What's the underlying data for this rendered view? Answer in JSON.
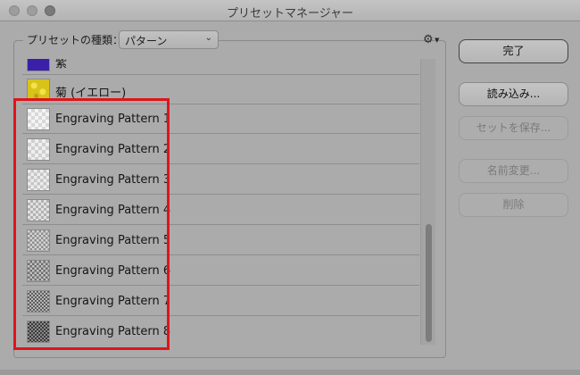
{
  "window": {
    "title": "プリセットマネージャー"
  },
  "preset": {
    "label": "プリセットの種類：",
    "selected": "パターン"
  },
  "list": {
    "items": [
      {
        "label": "紫",
        "thumb_color": "#3a1fa8",
        "pattern": "solid"
      },
      {
        "label": "菊 (イエロー)",
        "thumb_color": "#d8c31a",
        "pattern": "flower"
      },
      {
        "label": "Engraving Pattern 1",
        "pattern": "checker-light"
      },
      {
        "label": "Engraving Pattern 2",
        "pattern": "checker-light"
      },
      {
        "label": "Engraving Pattern 3",
        "pattern": "checker-light"
      },
      {
        "label": "Engraving Pattern 4",
        "pattern": "checker-mid"
      },
      {
        "label": "Engraving Pattern 5",
        "pattern": "checker-mid"
      },
      {
        "label": "Engraving Pattern 6",
        "pattern": "checker-dark"
      },
      {
        "label": "Engraving Pattern 7",
        "pattern": "checker-dark"
      },
      {
        "label": "Engraving Pattern 8",
        "pattern": "checker-darker"
      }
    ]
  },
  "buttons": {
    "done": "完了",
    "load": "読み込み...",
    "save_set": "セットを保存...",
    "rename": "名前変更...",
    "delete": "削除"
  },
  "colors": {
    "highlight": "#e0141a"
  }
}
